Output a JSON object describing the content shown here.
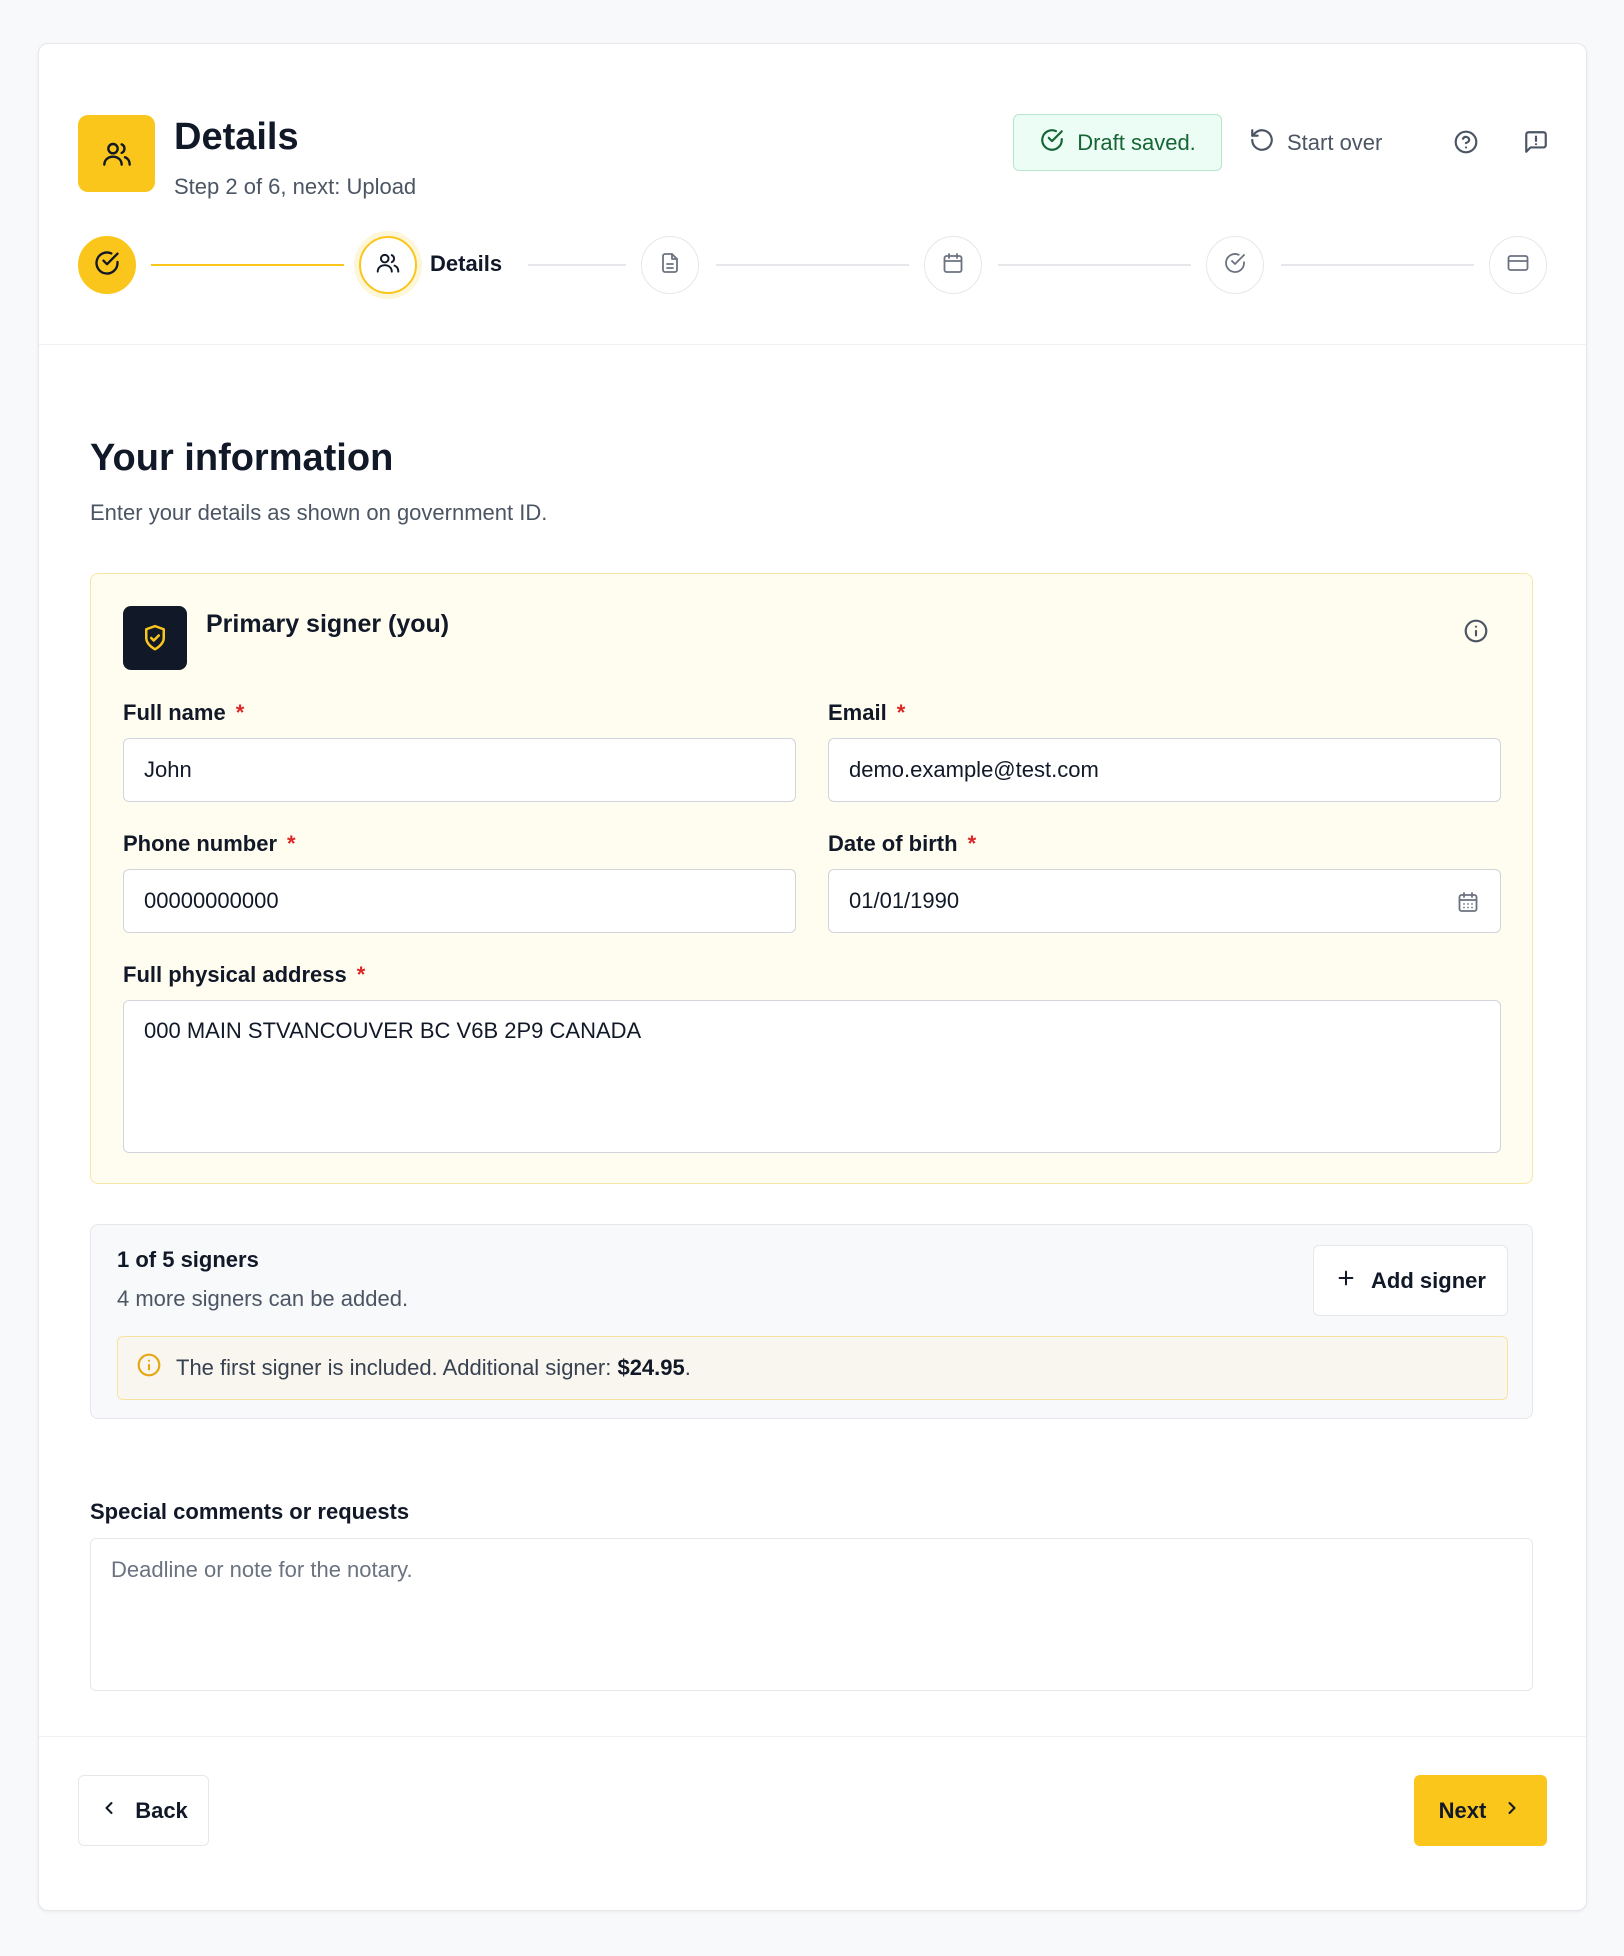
{
  "header": {
    "title": "Details",
    "subtitle": "Step 2 of 6, next: Upload",
    "draft_status": "Draft saved.",
    "start_over_label": "Start over"
  },
  "stepper": {
    "current_label": "Details",
    "steps": [
      {
        "icon": "check-circle-icon",
        "state": "complete"
      },
      {
        "icon": "users-icon",
        "state": "current"
      },
      {
        "icon": "document-icon",
        "state": "upcoming"
      },
      {
        "icon": "calendar-icon",
        "state": "upcoming"
      },
      {
        "icon": "check-circle-icon",
        "state": "upcoming"
      },
      {
        "icon": "credit-card-icon",
        "state": "upcoming"
      }
    ]
  },
  "section": {
    "title": "Your information",
    "subtitle": "Enter your details as shown on government ID."
  },
  "primary_signer": {
    "title": "Primary signer (you)",
    "required_mark": "*",
    "fields": {
      "full_name": {
        "label": "Full name",
        "value": "John"
      },
      "email": {
        "label": "Email",
        "value": "demo.example@test.com"
      },
      "phone": {
        "label": "Phone number",
        "value": "00000000000"
      },
      "dob": {
        "label": "Date of birth",
        "value": "01/01/1990"
      },
      "address": {
        "label": "Full physical address",
        "value": "000 MAIN STVANCOUVER BC  V6B 2P9 CANADA"
      }
    }
  },
  "signers": {
    "count_label": "1 of 5 signers",
    "remaining_label": "4 more signers can be added.",
    "add_label": "Add signer",
    "notice_text": "The first signer is included. Additional signer: ",
    "notice_price": "$24.95",
    "notice_end": "."
  },
  "comments": {
    "label": "Special comments or requests",
    "placeholder": "Deadline or note for the notary."
  },
  "footer": {
    "back_label": "Back",
    "next_label": "Next"
  },
  "colors": {
    "accent": "#fbc61c",
    "success": "#166534",
    "required": "#dc2626"
  }
}
